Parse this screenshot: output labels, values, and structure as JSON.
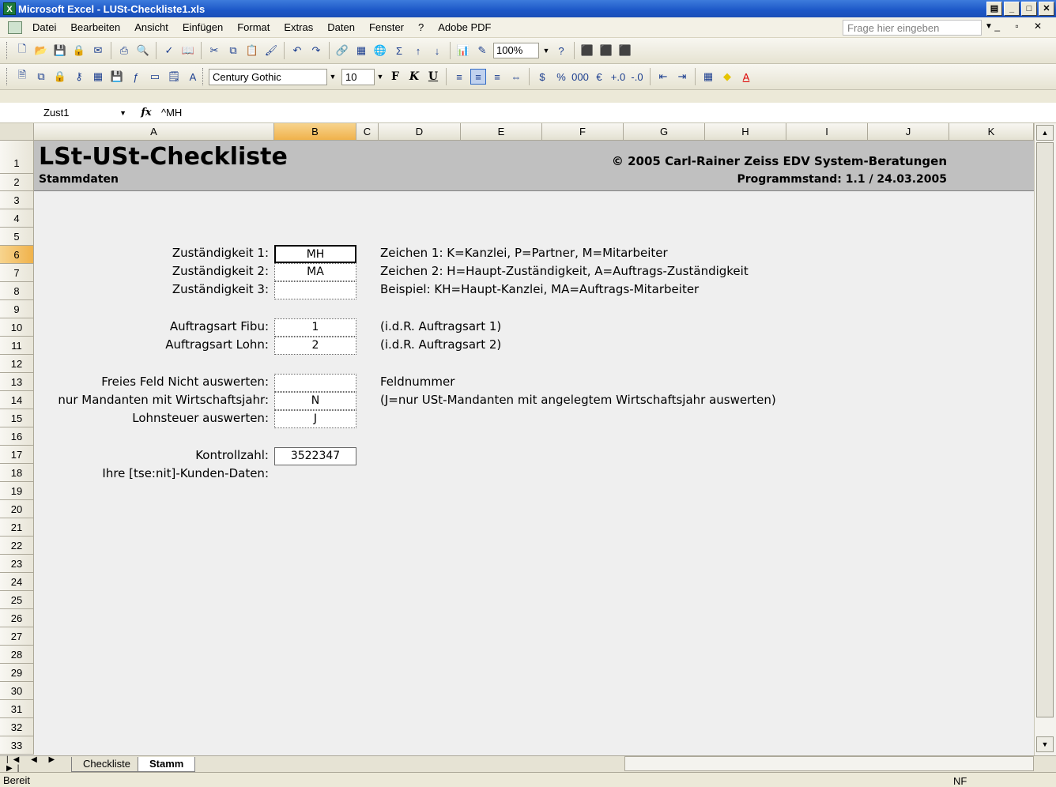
{
  "window": {
    "title": "Microsoft Excel - LUSt-Checkliste1.xls"
  },
  "menu": {
    "items": [
      "Datei",
      "Bearbeiten",
      "Ansicht",
      "Einfügen",
      "Format",
      "Extras",
      "Daten",
      "Fenster",
      "?",
      "Adobe PDF"
    ],
    "help_placeholder": "Frage hier eingeben"
  },
  "toolbar": {
    "zoom": "100%",
    "font": "Century Gothic",
    "size": "10"
  },
  "formula_bar": {
    "name_box": "Zust1",
    "fx": "fx",
    "formula": "^MH"
  },
  "columns": [
    "A",
    "B",
    "C",
    "D",
    "E",
    "F",
    "G",
    "H",
    "I",
    "J",
    "K"
  ],
  "rows": [
    "1",
    "2",
    "3",
    "4",
    "5",
    "6",
    "7",
    "8",
    "9",
    "10",
    "11",
    "12",
    "13",
    "14",
    "15",
    "16",
    "17",
    "18",
    "19",
    "20",
    "21",
    "22",
    "23",
    "24",
    "25",
    "26",
    "27",
    "28",
    "29",
    "30",
    "31",
    "32",
    "33"
  ],
  "banner": {
    "title": "LSt-USt-Checkliste",
    "subtitle": "Stammdaten",
    "copyright": "© 2005 Carl-Rainer Zeiss EDV System-Beratungen",
    "version": "Programmstand: 1.1 / 24.03.2005"
  },
  "fields": {
    "zust1_label": "Zuständigkeit 1:",
    "zust1_value": "MH",
    "zust2_label": "Zuständigkeit 2:",
    "zust2_value": "MA",
    "zust3_label": "Zuständigkeit 3:",
    "zust3_value": "",
    "fibu_label": "Auftragsart Fibu:",
    "fibu_value": "1",
    "lohn_label": "Auftragsart Lohn:",
    "lohn_value": "2",
    "freies_label": "Freies Feld Nicht auswerten:",
    "freies_value": "",
    "wj_label": "nur Mandanten mit Wirtschaftsjahr:",
    "wj_value": "N",
    "lst_label": "Lohnsteuer auswerten:",
    "lst_value": "J",
    "kontroll_label": "Kontrollzahl:",
    "kontroll_value": "3522347",
    "kunden_label": "Ihre [tse:nit]-Kunden-Daten:"
  },
  "descriptions": {
    "zeichen1": "Zeichen 1: K=Kanzlei, P=Partner, M=Mitarbeiter",
    "zeichen2": "Zeichen 2: H=Haupt-Zuständigkeit, A=Auftrags-Zuständigkeit",
    "beispiel": "Beispiel: KH=Haupt-Kanzlei, MA=Auftrags-Mitarbeiter",
    "fibu_hint": "(i.d.R. Auftragsart 1)",
    "lohn_hint": "(i.d.R. Auftragsart 2)",
    "feldnummer": "Feldnummer",
    "wj_hint": "(J=nur USt-Mandanten mit angelegtem Wirtschaftsjahr auswerten)"
  },
  "sheet_tabs": [
    "Checkliste",
    "Stamm"
  ],
  "status": {
    "ready": "Bereit",
    "nf": "NF"
  }
}
